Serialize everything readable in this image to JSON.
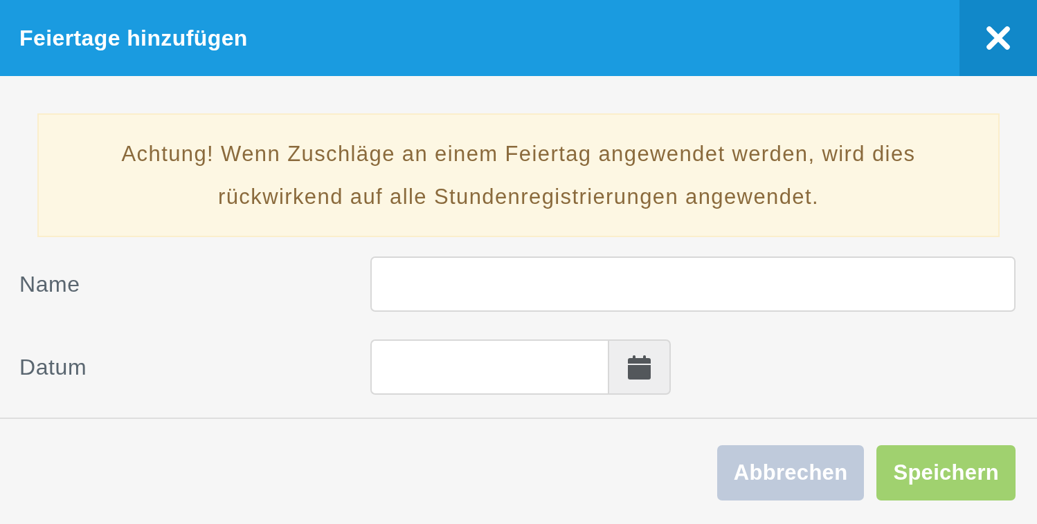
{
  "dialog": {
    "title": "Feiertage hinzufügen"
  },
  "alert": {
    "text": "Achtung! Wenn Zuschläge an einem Feiertag angewendet werden, wird dies rückwirkend auf alle Stundenregistrierungen angewendet."
  },
  "fields": [
    {
      "label": "Name",
      "kind": "text"
    },
    {
      "label": "Datum",
      "kind": "date"
    }
  ],
  "buttons": [
    {
      "label": "Abbrechen",
      "kind": "cancel"
    },
    {
      "label": "Speichern",
      "kind": "save"
    }
  ]
}
